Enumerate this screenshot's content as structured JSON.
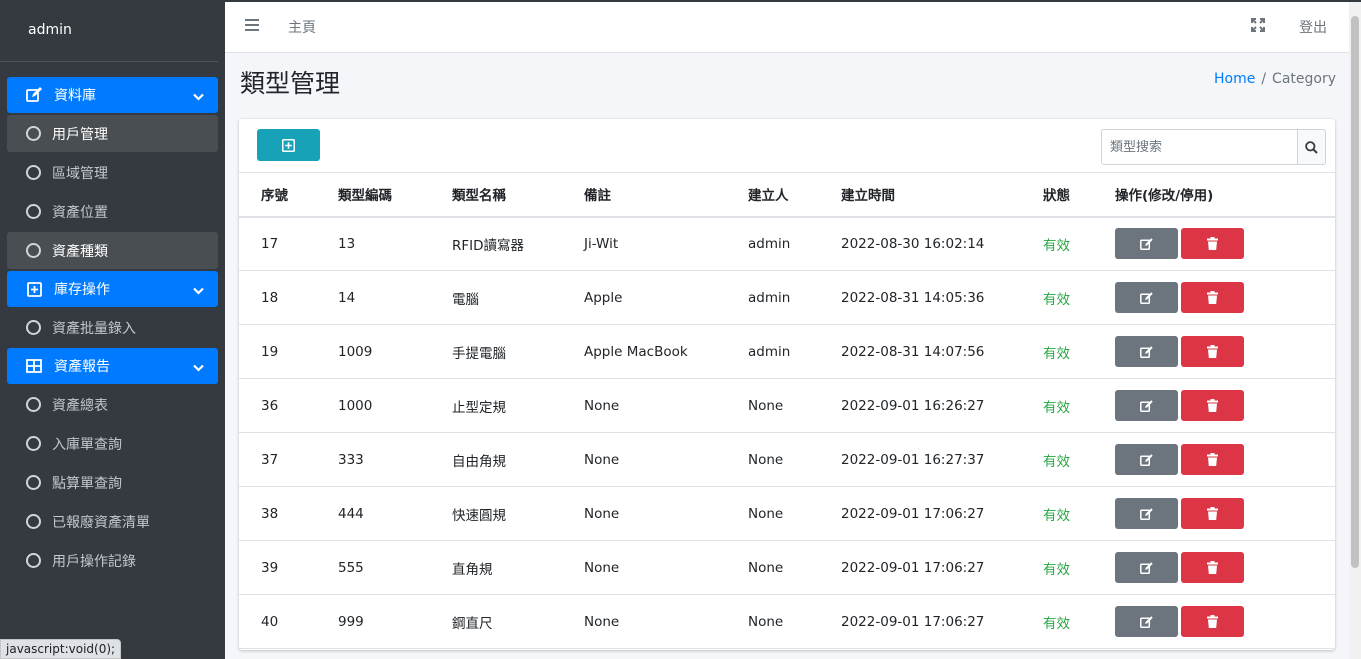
{
  "sidebar": {
    "brand": "admin",
    "items": [
      {
        "label": "資料庫",
        "type": "header",
        "icon": "edit-icon"
      },
      {
        "label": "用戶管理",
        "type": "sub",
        "active": true
      },
      {
        "label": "區域管理",
        "type": "sub"
      },
      {
        "label": "資產位置",
        "type": "sub"
      },
      {
        "label": "資產種類",
        "type": "sub",
        "active": true
      },
      {
        "label": "庫存操作",
        "type": "header",
        "icon": "plus-square-icon"
      },
      {
        "label": "資產批量錄入",
        "type": "sub"
      },
      {
        "label": "資產報告",
        "type": "header",
        "icon": "table-icon"
      },
      {
        "label": "資產總表",
        "type": "sub"
      },
      {
        "label": "入庫單查詢",
        "type": "sub"
      },
      {
        "label": "點算單查詢",
        "type": "sub"
      },
      {
        "label": "已報廢資產清單",
        "type": "sub"
      },
      {
        "label": "用戶操作記錄",
        "type": "sub"
      }
    ]
  },
  "navbar": {
    "home": "主頁",
    "logout": "登出"
  },
  "page": {
    "title": "類型管理",
    "breadcrumb_home": "Home",
    "breadcrumb_sep": "/",
    "breadcrumb_current": "Category"
  },
  "search": {
    "placeholder": "類型搜索"
  },
  "table": {
    "headers": [
      "序號",
      "類型編碼",
      "類型名稱",
      "備註",
      "建立人",
      "建立時間",
      "狀態",
      "操作(修改/停用)"
    ],
    "rows": [
      [
        "17",
        "13",
        "RFID讀寫器",
        "Ji-Wit",
        "admin",
        "2022-08-30 16:02:14",
        "有效"
      ],
      [
        "18",
        "14",
        "電腦",
        "Apple",
        "admin",
        "2022-08-31 14:05:36",
        "有效"
      ],
      [
        "19",
        "1009",
        "手提電腦",
        "Apple MacBook",
        "admin",
        "2022-08-31 14:07:56",
        "有效"
      ],
      [
        "36",
        "1000",
        "止型定規",
        "None",
        "None",
        "2022-09-01 16:26:27",
        "有效"
      ],
      [
        "37",
        "333",
        "自由角規",
        "None",
        "None",
        "2022-09-01 16:27:37",
        "有效"
      ],
      [
        "38",
        "444",
        "快速圓規",
        "None",
        "None",
        "2022-09-01 17:06:27",
        "有效"
      ],
      [
        "39",
        "555",
        "直角規",
        "None",
        "None",
        "2022-09-01 17:06:27",
        "有效"
      ],
      [
        "40",
        "999",
        "鋼直尺",
        "None",
        "None",
        "2022-09-01 17:06:27",
        "有效"
      ]
    ]
  },
  "statusbar": "javascript:void(0);",
  "colors": {
    "sidebar_bg": "#343a40",
    "primary": "#007bff",
    "info": "#17a2b8",
    "secondary": "#6c757d",
    "danger": "#dc3545",
    "success": "#28a745"
  }
}
